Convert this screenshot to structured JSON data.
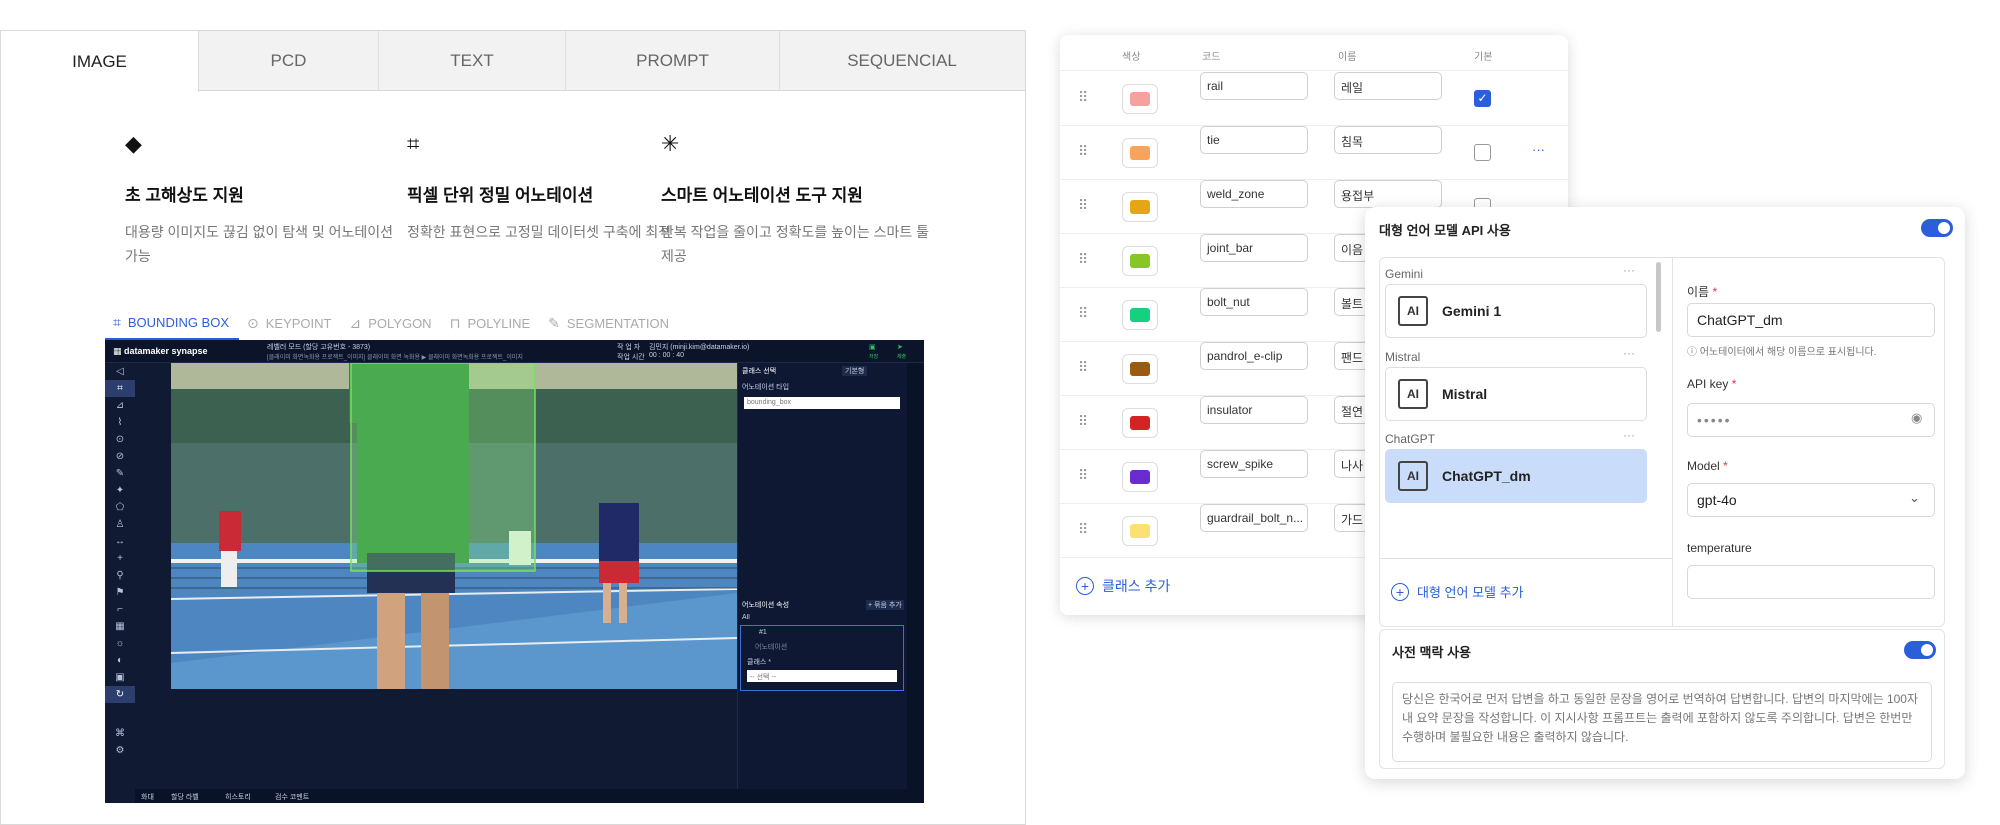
{
  "left": {
    "tabs": [
      "IMAGE",
      "PCD",
      "TEXT",
      "PROMPT",
      "SEQUENCIAL"
    ],
    "features": [
      {
        "icon": "◆",
        "title": "초 고해상도 지원",
        "desc": "대용량 이미지도 끊김 없이 탐색 및 어노테이션 가능"
      },
      {
        "icon": "⌗",
        "title": "픽셀 단위 정밀 어노테이션",
        "desc": "정확한 표현으로 고정밀 데이터셋 구축에 최적"
      },
      {
        "icon": "✳",
        "title": "스마트 어노테이션 도구 지원",
        "desc": "반복 작업을 줄이고 정확도를 높이는 스마트 툴 제공"
      }
    ],
    "annotation_tabs": [
      {
        "label": "BOUNDING BOX",
        "icon": "⌗"
      },
      {
        "label": "KEYPOINT",
        "icon": "⊙"
      },
      {
        "label": "POLYGON",
        "icon": "⊿"
      },
      {
        "label": "POLYLINE",
        "icon": "⊓"
      },
      {
        "label": "SEGMENTATION",
        "icon": "✎"
      }
    ]
  },
  "editor": {
    "brand": "datamaker synapse",
    "mode": "레벨러 모드 (할당 고유번호 - 3873)",
    "path": "[클래이미 화면녹화용 프로젝트_이미지] 클래이미 화면 녹화용 ▶ 클래이미 화면녹화용 프로젝트_이미지",
    "worker_label": "작 업 자",
    "worker": "김민지 (minji.kim@datamaker.io)",
    "time_label": "작업 시간",
    "time": "00 : 00 : 40",
    "top_icons": [
      "저장",
      "제출"
    ],
    "class_select": "클래스 선택",
    "basic": "기본형",
    "ann_type_label": "어노테이션 타입",
    "ann_type": "bounding_box",
    "ann_attr": "어노테이션 속성",
    "all": "All",
    "group_add": "+ 묶음 추가",
    "item_id": "#1",
    "item_desc": "어노테이션",
    "class_label": "클래스 *",
    "class_select_placeholder": "-- 선택 --",
    "bottom": [
      "화대",
      "할당 라벨",
      "히스토리",
      "검수 코멘트"
    ]
  },
  "classes": {
    "headers": [
      "색상",
      "코드",
      "이름",
      "기본"
    ],
    "rows": [
      {
        "color": "#f6a0a0",
        "code": "rail",
        "name": "레일",
        "default": true
      },
      {
        "color": "#f8a35c",
        "code": "tie",
        "name": "침목",
        "default": false
      },
      {
        "color": "#e2a712",
        "code": "weld_zone",
        "name": "용접부",
        "default": false
      },
      {
        "color": "#86c726",
        "code": "joint_bar",
        "name": "이음",
        "default": false
      },
      {
        "color": "#15d07e",
        "code": "bolt_nut",
        "name": "볼트",
        "default": false
      },
      {
        "color": "#9b5a12",
        "code": "pandrol_e-clip",
        "name": "팬드",
        "default": false
      },
      {
        "color": "#d42323",
        "code": "insulator",
        "name": "절연",
        "default": false
      },
      {
        "color": "#6a2bd1",
        "code": "screw_spike",
        "name": "나사",
        "default": false
      },
      {
        "color": "#fbe072",
        "code": "guardrail_bolt_n...",
        "name": "가드",
        "default": false
      }
    ],
    "more": "···",
    "add": "클래스 추가"
  },
  "llm": {
    "title": "대형 언어 모델 API 사용",
    "groups": [
      {
        "group": "Gemini",
        "name": "Gemini 1"
      },
      {
        "group": "Mistral",
        "name": "Mistral"
      },
      {
        "group": "ChatGPT",
        "name": "ChatGPT_dm"
      }
    ],
    "ai_icon": "AI",
    "add_model": "대형 언어 모델 추가",
    "name_label": "이름",
    "name_value": "ChatGPT_dm",
    "name_hint": "어노테이터에서 해당 이름으로 표시됩니다.",
    "apikey_label": "API key",
    "apikey_value": "•••••",
    "model_label": "Model",
    "model_value": "gpt-4o",
    "temperature_label": "temperature",
    "context_title": "사전 맥락 사용",
    "context_text": "당신은 한국어로 먼저 답변을 하고 동일한 문장을 영어로 번역하여 답변합니다. 답변의 마지막에는 100자 내 요약 문장을 작성합니다. 이 지시사항 프롬프트는 출력에 포함하지 않도록 주의합니다. 답변은 한번만 수행하며 불필요한 내용은 출력하지 않습니다.",
    "colors": {
      "accent": "#2b5fd9",
      "selected": "#c9ddfa"
    }
  }
}
